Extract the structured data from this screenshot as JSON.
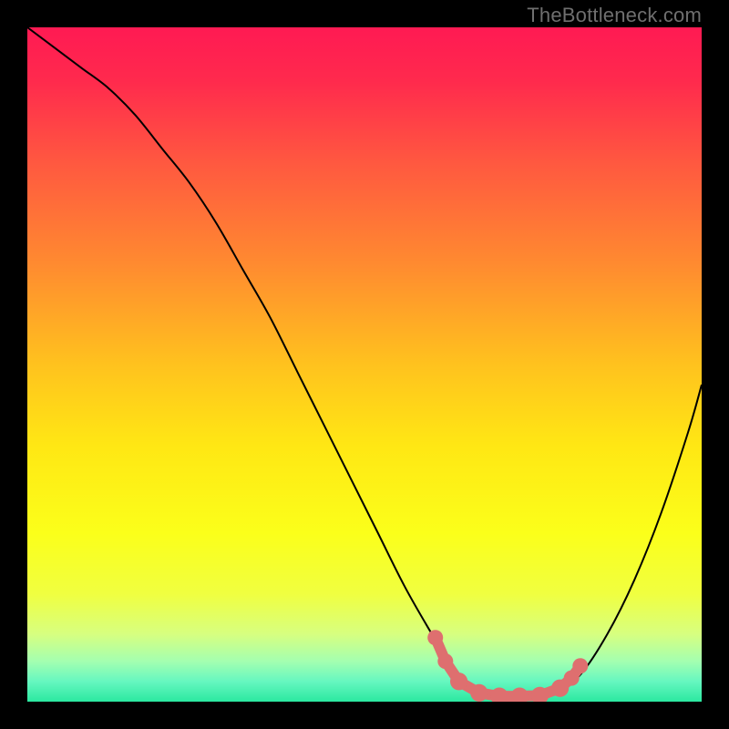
{
  "watermark": "TheBottleneck.com",
  "colors": {
    "gradient_stops": [
      {
        "offset": 0.0,
        "color": "#ff1a53"
      },
      {
        "offset": 0.08,
        "color": "#ff2a4d"
      },
      {
        "offset": 0.2,
        "color": "#ff5840"
      },
      {
        "offset": 0.35,
        "color": "#ff8a30"
      },
      {
        "offset": 0.5,
        "color": "#ffc21e"
      },
      {
        "offset": 0.62,
        "color": "#ffe714"
      },
      {
        "offset": 0.75,
        "color": "#fbff1a"
      },
      {
        "offset": 0.84,
        "color": "#f0ff40"
      },
      {
        "offset": 0.9,
        "color": "#d7ff80"
      },
      {
        "offset": 0.94,
        "color": "#a4ffb0"
      },
      {
        "offset": 0.97,
        "color": "#66f7c0"
      },
      {
        "offset": 1.0,
        "color": "#2be8a0"
      }
    ],
    "curve_stroke": "#000000",
    "marker_fill": "#de6f6f",
    "marker_stroke": "#de6f6f"
  },
  "chart_data": {
    "type": "line",
    "title": "",
    "xlabel": "",
    "ylabel": "",
    "xlim": [
      0,
      100
    ],
    "ylim": [
      0,
      100
    ],
    "grid": false,
    "series": [
      {
        "name": "bottleneck-curve",
        "x": [
          0,
          4,
          8,
          12,
          16,
          20,
          24,
          28,
          32,
          36,
          40,
          44,
          48,
          52,
          56,
          60,
          63,
          66,
          70,
          74,
          78,
          82,
          86,
          90,
          94,
          98,
          100
        ],
        "y": [
          100,
          97,
          94,
          91,
          87,
          82,
          77,
          71,
          64,
          57,
          49,
          41,
          33,
          25,
          17,
          10,
          5,
          2,
          1,
          1,
          1,
          4,
          10,
          18,
          28,
          40,
          47
        ]
      }
    ],
    "markers": [
      {
        "x": 60.5,
        "y": 9.5,
        "r": 1.15
      },
      {
        "x": 62.0,
        "y": 6.0,
        "r": 1.15
      },
      {
        "x": 64.0,
        "y": 3.0,
        "r": 1.3
      },
      {
        "x": 67.0,
        "y": 1.3,
        "r": 1.3
      },
      {
        "x": 70.0,
        "y": 0.8,
        "r": 1.3
      },
      {
        "x": 73.0,
        "y": 0.8,
        "r": 1.3
      },
      {
        "x": 76.0,
        "y": 0.9,
        "r": 1.3
      },
      {
        "x": 79.0,
        "y": 2.0,
        "r": 1.3
      },
      {
        "x": 80.7,
        "y": 3.5,
        "r": 1.15
      },
      {
        "x": 82.0,
        "y": 5.3,
        "r": 1.15
      }
    ],
    "marker_segment": {
      "x": [
        60.5,
        62.0,
        64.0,
        67.0,
        70.0,
        73.0,
        76.0,
        79.0,
        80.7,
        82.0
      ],
      "y": [
        9.5,
        6.0,
        3.0,
        1.3,
        0.8,
        0.8,
        0.9,
        2.0,
        3.5,
        5.3
      ]
    }
  }
}
